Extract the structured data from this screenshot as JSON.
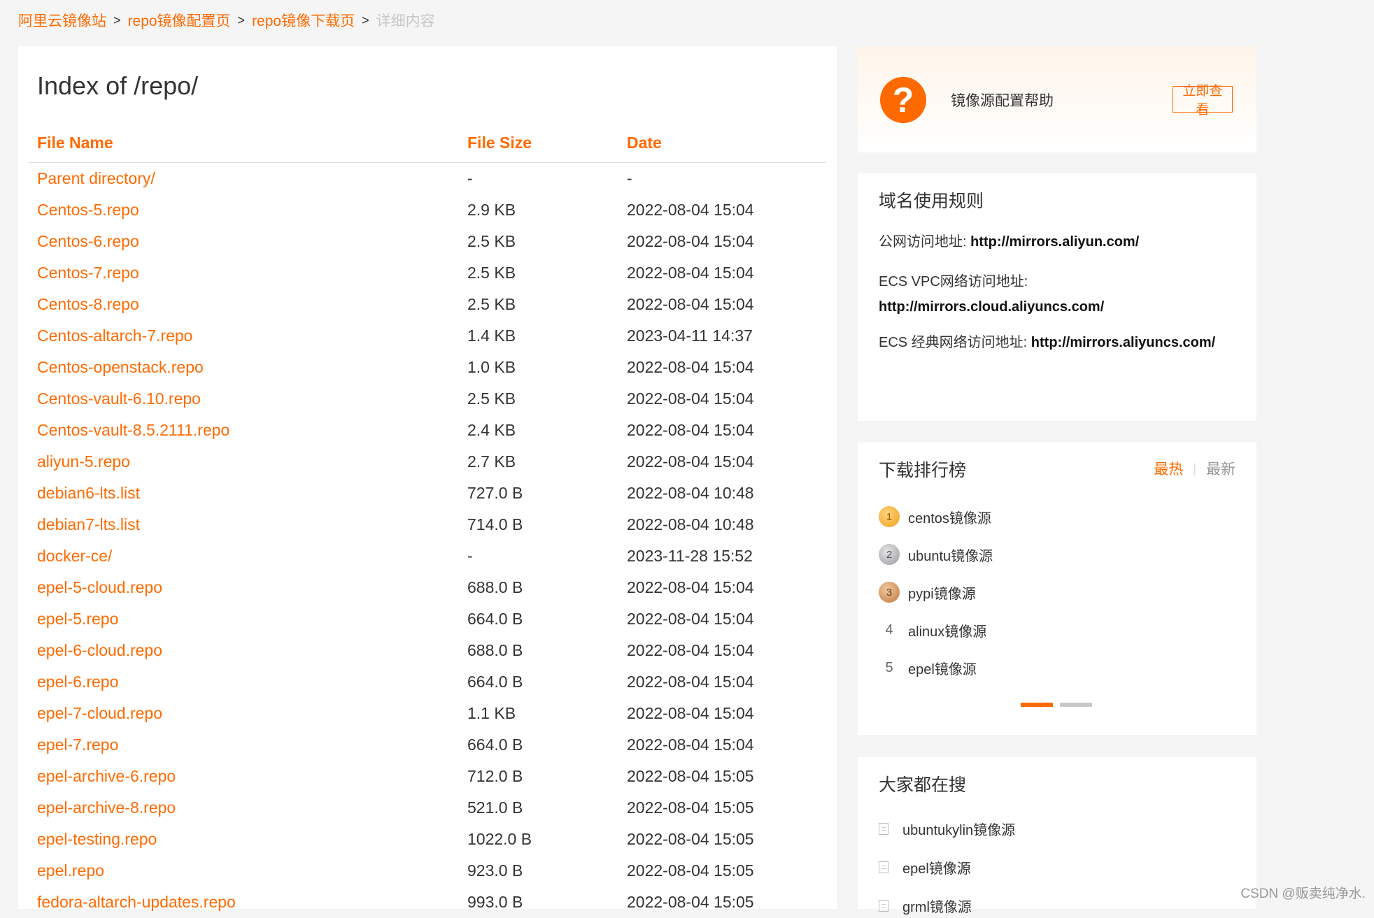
{
  "breadcrumb": {
    "items": [
      "阿里云镜像站",
      "repo镜像配置页",
      "repo镜像下载页",
      "详细内容"
    ],
    "separator": ">"
  },
  "main": {
    "title": "Index of /repo/",
    "columns": [
      "File Name",
      "File Size",
      "Date"
    ],
    "rows": [
      {
        "name": "Parent directory/",
        "size": "-",
        "date": "-"
      },
      {
        "name": "Centos-5.repo",
        "size": "2.9 KB",
        "date": "2022-08-04 15:04"
      },
      {
        "name": "Centos-6.repo",
        "size": "2.5 KB",
        "date": "2022-08-04 15:04"
      },
      {
        "name": "Centos-7.repo",
        "size": "2.5 KB",
        "date": "2022-08-04 15:04"
      },
      {
        "name": "Centos-8.repo",
        "size": "2.5 KB",
        "date": "2022-08-04 15:04"
      },
      {
        "name": "Centos-altarch-7.repo",
        "size": "1.4 KB",
        "date": "2023-04-11 14:37"
      },
      {
        "name": "Centos-openstack.repo",
        "size": "1.0 KB",
        "date": "2022-08-04 15:04"
      },
      {
        "name": "Centos-vault-6.10.repo",
        "size": "2.5 KB",
        "date": "2022-08-04 15:04"
      },
      {
        "name": "Centos-vault-8.5.2111.repo",
        "size": "2.4 KB",
        "date": "2022-08-04 15:04"
      },
      {
        "name": "aliyun-5.repo",
        "size": "2.7 KB",
        "date": "2022-08-04 15:04"
      },
      {
        "name": "debian6-lts.list",
        "size": "727.0 B",
        "date": "2022-08-04 10:48"
      },
      {
        "name": "debian7-lts.list",
        "size": "714.0 B",
        "date": "2022-08-04 10:48"
      },
      {
        "name": "docker-ce/",
        "size": "-",
        "date": "2023-11-28 15:52"
      },
      {
        "name": "epel-5-cloud.repo",
        "size": "688.0 B",
        "date": "2022-08-04 15:04"
      },
      {
        "name": "epel-5.repo",
        "size": "664.0 B",
        "date": "2022-08-04 15:04"
      },
      {
        "name": "epel-6-cloud.repo",
        "size": "688.0 B",
        "date": "2022-08-04 15:04"
      },
      {
        "name": "epel-6.repo",
        "size": "664.0 B",
        "date": "2022-08-04 15:04"
      },
      {
        "name": "epel-7-cloud.repo",
        "size": "1.1 KB",
        "date": "2022-08-04 15:04"
      },
      {
        "name": "epel-7.repo",
        "size": "664.0 B",
        "date": "2022-08-04 15:04"
      },
      {
        "name": "epel-archive-6.repo",
        "size": "712.0 B",
        "date": "2022-08-04 15:05"
      },
      {
        "name": "epel-archive-8.repo",
        "size": "521.0 B",
        "date": "2022-08-04 15:05"
      },
      {
        "name": "epel-testing.repo",
        "size": "1022.0 B",
        "date": "2022-08-04 15:05"
      },
      {
        "name": "epel.repo",
        "size": "923.0 B",
        "date": "2022-08-04 15:05"
      },
      {
        "name": "fedora-altarch-updates.repo",
        "size": "993.0 B",
        "date": "2022-08-04 15:05"
      }
    ]
  },
  "help": {
    "icon": "question-icon",
    "text": "镜像源配置帮助",
    "button": "立即查看"
  },
  "rules": {
    "title": "域名使用规则",
    "public_label": "公网访问地址: ",
    "public_url": "http://mirrors.aliyun.com/",
    "vpc_label": "ECS VPC网络访问地址:",
    "vpc_url": "http://mirrors.cloud.aliyuncs.com/",
    "classic_label": "ECS 经典网络访问地址: ",
    "classic_url": "http://mirrors.aliyuncs.com/"
  },
  "ranking": {
    "title": "下载排行榜",
    "tab_hot": "最热",
    "tab_new": "最新",
    "items": [
      {
        "rank": "1",
        "name": "centos镜像源"
      },
      {
        "rank": "2",
        "name": "ubuntu镜像源"
      },
      {
        "rank": "3",
        "name": "pypi镜像源"
      },
      {
        "rank": "4",
        "name": "alinux镜像源"
      },
      {
        "rank": "5",
        "name": "epel镜像源"
      }
    ]
  },
  "search": {
    "title": "大家都在搜",
    "items": [
      "ubuntukylin镜像源",
      "epel镜像源",
      "grml镜像源"
    ]
  },
  "watermark": "CSDN @贩卖纯净水.",
  "colors": {
    "accent": "#ff6a00",
    "background": "#f5f5f5",
    "muted": "#c8c8c8"
  }
}
